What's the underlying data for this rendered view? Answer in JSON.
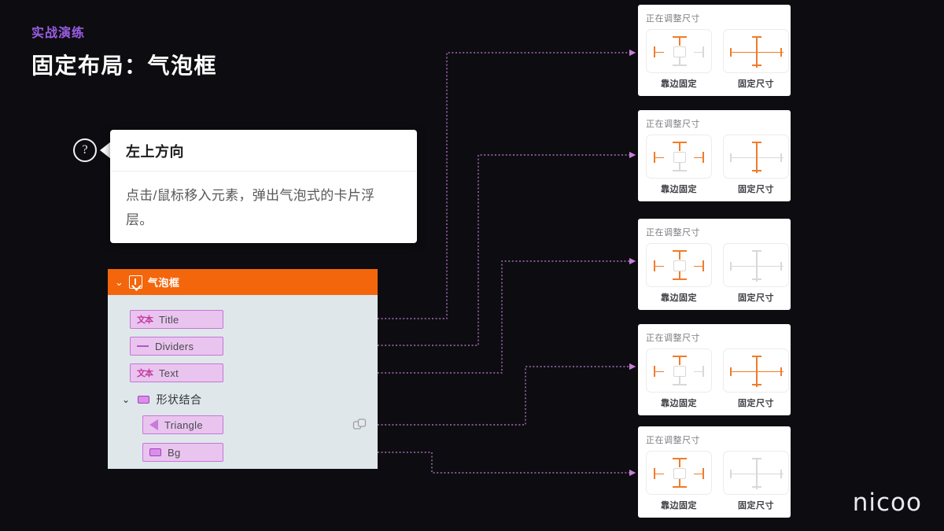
{
  "header": {
    "eyebrow": "实战演练",
    "title": "固定布局：气泡框"
  },
  "tooltip_demo": {
    "help_icon_glyph": "?",
    "title": "左上方向",
    "body": "点击/鼠标移入元素，弹出气泡式的卡片浮层。"
  },
  "layers_panel": {
    "header": {
      "chevron": "⌄",
      "icon": "component-symbol-icon",
      "label": "气泡框"
    },
    "rows": [
      {
        "icon": "text-icon",
        "icon_glyph": "文本",
        "label": "Title"
      },
      {
        "icon": "divider-icon",
        "icon_glyph": "",
        "label": "Dividers"
      },
      {
        "icon": "text-icon",
        "icon_glyph": "文本",
        "label": "Text"
      }
    ],
    "group": {
      "chevron": "⌄",
      "icon": "shape-combine-icon",
      "label": "形状结合",
      "children": [
        {
          "icon": "triangle-icon",
          "label": "Triangle"
        },
        {
          "icon": "rectangle-icon",
          "label": "Bg"
        }
      ]
    },
    "boolean_icon": "boolean-union-icon"
  },
  "cards": [
    {
      "title": "正在调整尺寸",
      "pin_label": "靠边固定",
      "size_label": "固定尺寸",
      "pins": {
        "left": true,
        "right": false,
        "top": true,
        "bottom": false
      },
      "size": {
        "horizontal": true,
        "vertical": true
      }
    },
    {
      "title": "正在调整尺寸",
      "pin_label": "靠边固定",
      "size_label": "固定尺寸",
      "pins": {
        "left": true,
        "right": true,
        "top": true,
        "bottom": false
      },
      "size": {
        "horizontal": false,
        "vertical": true
      }
    },
    {
      "title": "正在调整尺寸",
      "pin_label": "靠边固定",
      "size_label": "固定尺寸",
      "pins": {
        "left": true,
        "right": true,
        "top": true,
        "bottom": true
      },
      "size": {
        "horizontal": false,
        "vertical": false
      }
    },
    {
      "title": "正在调整尺寸",
      "pin_label": "靠边固定",
      "size_label": "固定尺寸",
      "pins": {
        "left": true,
        "right": false,
        "top": true,
        "bottom": false
      },
      "size": {
        "horizontal": true,
        "vertical": true
      }
    },
    {
      "title": "正在调整尺寸",
      "pin_label": "靠边固定",
      "size_label": "固定尺寸",
      "pins": {
        "left": true,
        "right": true,
        "top": true,
        "bottom": true
      },
      "size": {
        "horizontal": false,
        "vertical": false
      }
    }
  ],
  "watermark": "nicoo",
  "colors": {
    "background": "#0d0d11",
    "accent_purple": "#9b5de5",
    "layer_orange": "#f4660c",
    "pin_active": "#f07c2a",
    "pin_inactive": "#d8d8d8",
    "wire": "#c77fd8",
    "panel_body": "#dfe7eb",
    "row_fill": "#e9c4ee",
    "row_border": "#c874d8"
  }
}
